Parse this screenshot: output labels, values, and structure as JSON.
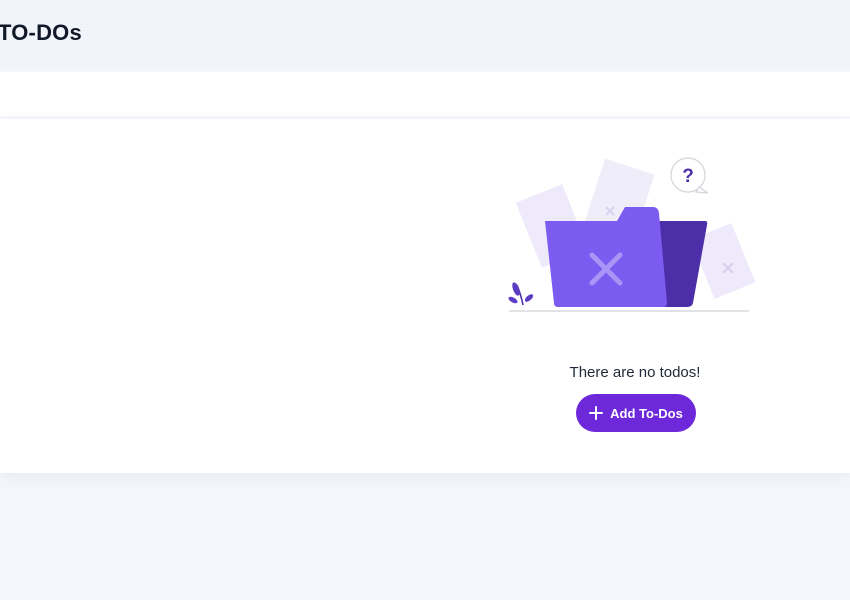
{
  "header": {
    "title": "TO-DOs"
  },
  "empty_state": {
    "message": "There are no todos!",
    "illustration_icon": "empty-folder-icon",
    "add_button_label": "Add To-Dos",
    "add_button_icon": "plus-icon"
  },
  "colors": {
    "accent": "#6d28d9",
    "folder_front": "#7c5cf0",
    "folder_back": "#4c2fa8",
    "page_background": "#f4f6fc"
  }
}
